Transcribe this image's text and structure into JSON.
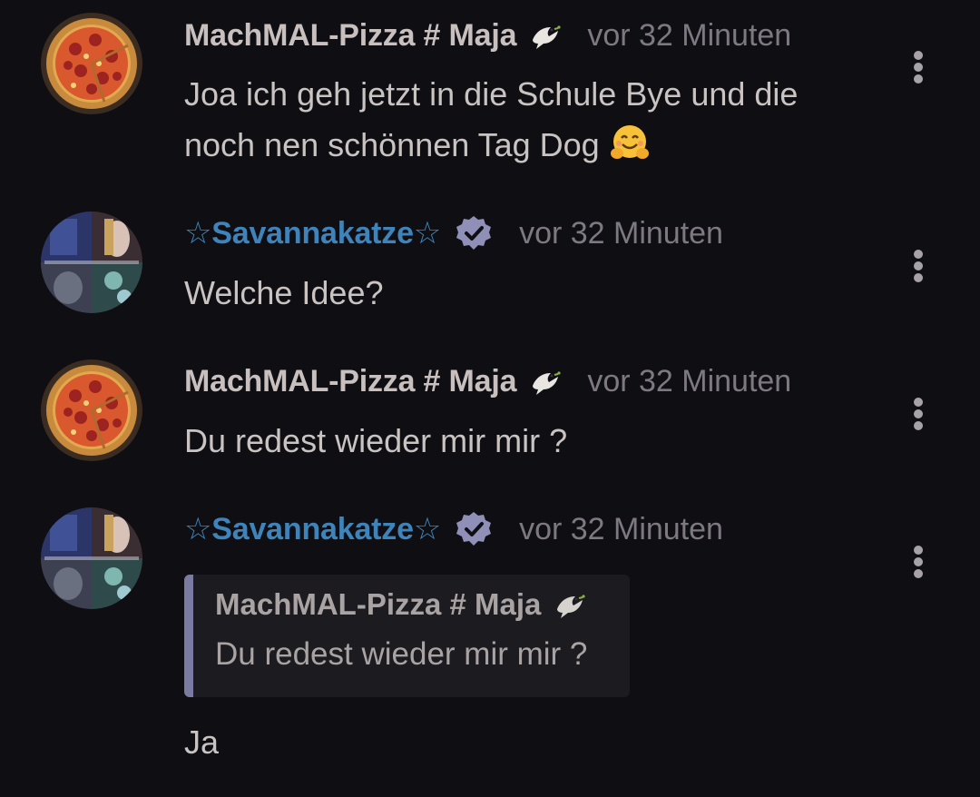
{
  "comments": [
    {
      "username": "MachMAL-Pizza # Maja",
      "user_badge_icon": "dove-icon",
      "timestamp": "vor 32 Minuten",
      "text_line1": "Joa ich geh jetzt in die Schule Bye und die",
      "text_line2": "noch nen schönnen Tag Dog",
      "trailing_emoji": "hugging-face-emoji",
      "avatar": "pizza-avatar"
    },
    {
      "username": "☆Savannakatze☆",
      "user_badge_icon": "verified-badge-icon",
      "timestamp": "vor 32 Minuten",
      "text": "Welche Idee?",
      "avatar": "collage-avatar"
    },
    {
      "username": "MachMAL-Pizza # Maja",
      "user_badge_icon": "dove-icon",
      "timestamp": "vor 32 Minuten",
      "text": "Du redest wieder mir mir ?",
      "avatar": "pizza-avatar"
    },
    {
      "username": "☆Savannakatze☆",
      "user_badge_icon": "verified-badge-icon",
      "timestamp": "vor 32 Minuten",
      "quote": {
        "username": "MachMAL-Pizza # Maja",
        "text": "Du redest wieder mir mir ?"
      },
      "text": "Ja",
      "avatar": "collage-avatar"
    }
  ],
  "colors": {
    "background": "#0f0e12",
    "username_default": "#c7c0bf",
    "username_highlight": "#3e84ba",
    "timestamp": "#7d7980",
    "message_text": "#c9c3c2",
    "quote_background": "#1c1b1f",
    "quote_bar": "#7b7aa0",
    "verified_badge": "#8f8fb8"
  }
}
